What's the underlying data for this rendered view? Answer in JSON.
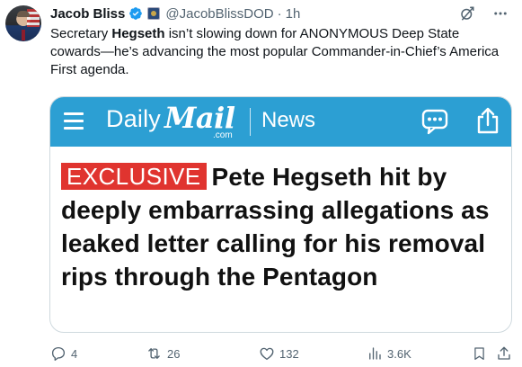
{
  "author": {
    "name": "Jacob Bliss",
    "handle": "@JacobBlissDOD",
    "time": "1h"
  },
  "tweet": {
    "text_before": "Secretary ",
    "text_bold": "Hegseth",
    "text_after": " isn’t slowing down for ANONYMOUS Deep State cowards—he’s advancing the most popular Commander-in-Chief’s America First agenda."
  },
  "card": {
    "brand_daily": "Daily",
    "brand_mail": "Mail",
    "brand_com": ".com",
    "section": "News",
    "tag": "EXCLUSIVE",
    "headline": "Pete Hegseth hit by deeply embarrassing allegations as leaked letter calling for his removal rips through the Pentagon"
  },
  "actions": {
    "replies": "4",
    "reposts": "26",
    "likes": "132",
    "views": "3.6K"
  },
  "colors": {
    "dailymail_blue": "#2c9fd3",
    "exclusive_red": "#e0342f",
    "verified_blue": "#1d9bf0",
    "muted": "#536471"
  },
  "icons": [
    "verified-badge-icon",
    "affiliate-badge-icon",
    "grok-icon",
    "more-icon",
    "hamburger-icon",
    "comment-icon",
    "share-icon",
    "reply-icon",
    "repost-icon",
    "like-icon",
    "views-icon",
    "bookmark-icon",
    "share-post-icon"
  ]
}
